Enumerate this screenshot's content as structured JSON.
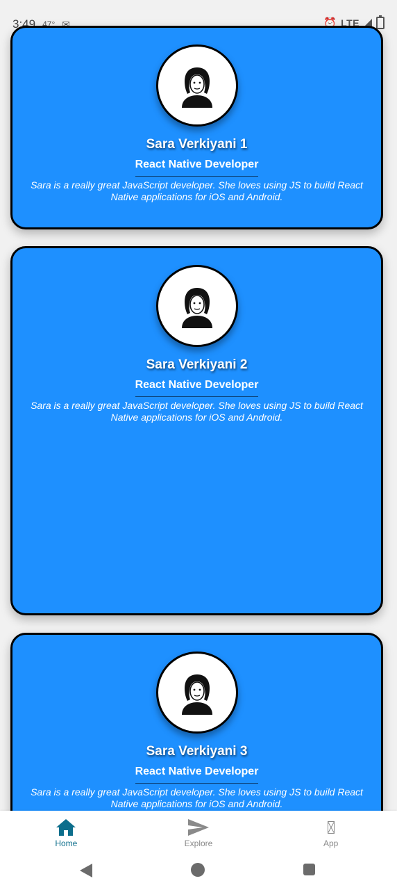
{
  "status_bar": {
    "time": "3:49",
    "temp": "47°",
    "network": "LTE"
  },
  "cards": [
    {
      "name": "Sara Verkiyani 1",
      "role": "React Native Developer",
      "description": "Sara is a really great JavaScript developer. She loves using JS to build React Native applications for iOS and Android."
    },
    {
      "name": "Sara Verkiyani 2",
      "role": "React Native Developer",
      "description": "Sara is a really great JavaScript developer. She loves using JS to build React Native applications for iOS and Android."
    },
    {
      "name": "Sara Verkiyani 3",
      "role": "React Native Developer",
      "description": "Sara is a really great JavaScript developer. She loves using JS to build React Native applications for iOS and Android."
    }
  ],
  "tabs": [
    {
      "label": "Home",
      "icon": "home-icon",
      "active": true
    },
    {
      "label": "Explore",
      "icon": "send-icon",
      "active": false
    },
    {
      "label": "App",
      "icon": "missing-glyph-icon",
      "active": false
    }
  ],
  "colors": {
    "card_background": "#1e90ff",
    "card_border": "#000000",
    "active_tab": "#0d6e8c",
    "inactive_tab": "#8a8a8a",
    "page_background": "#f1f1f1"
  }
}
